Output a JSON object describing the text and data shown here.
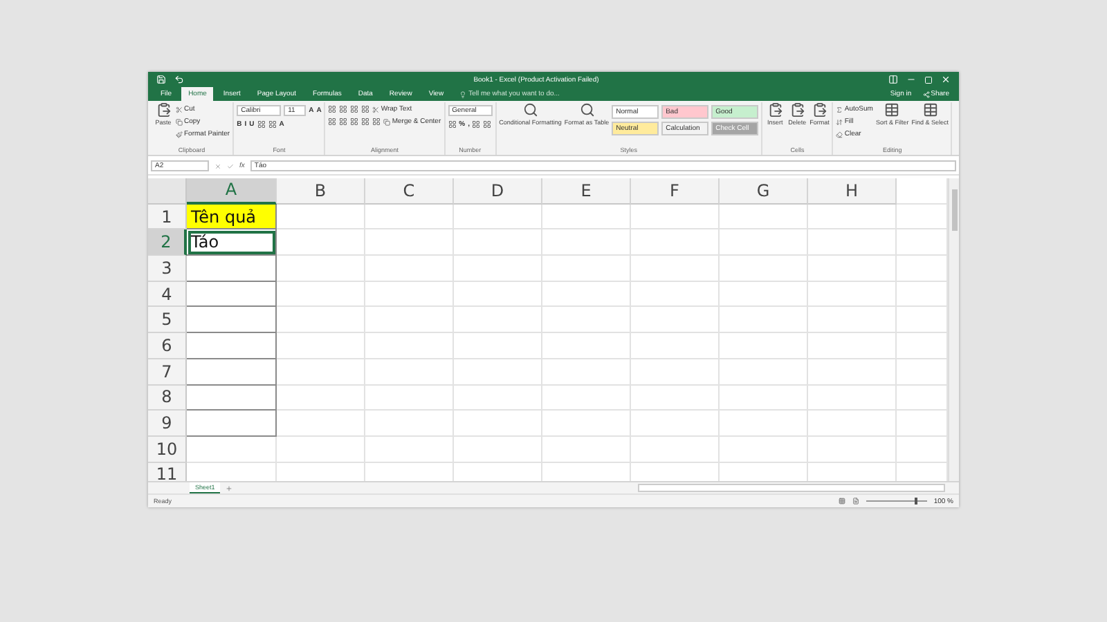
{
  "window": {
    "title": "Book1 - Excel (Product Activation Failed)"
  },
  "ribbon_tabs": [
    {
      "label": "File",
      "selected": false
    },
    {
      "label": "Home",
      "selected": true
    },
    {
      "label": "Insert",
      "selected": false
    },
    {
      "label": "Page Layout",
      "selected": false
    },
    {
      "label": "Formulas",
      "selected": false
    },
    {
      "label": "Data",
      "selected": false
    },
    {
      "label": "Review",
      "selected": false
    },
    {
      "label": "View",
      "selected": false
    }
  ],
  "tell_me": {
    "placeholder": "Tell me what you want to do..."
  },
  "account": {
    "sign_in": "Sign in",
    "share": "Share"
  },
  "ribbon_groups": [
    {
      "label": "Clipboard",
      "blocks": [
        {
          "kind": "large",
          "label": "Paste"
        },
        {
          "kind": "stack",
          "rows": [
            {
              "items": [
                {
                  "kind": "icon-text",
                  "label": "Cut"
                }
              ]
            },
            {
              "items": [
                {
                  "kind": "icon-text",
                  "label": "Copy"
                }
              ]
            },
            {
              "items": [
                {
                  "kind": "icon-text",
                  "label": "Format Painter"
                }
              ]
            }
          ]
        }
      ]
    },
    {
      "label": "Font",
      "blocks": [
        {
          "kind": "stack",
          "rows": [
            {
              "items": [
                {
                  "kind": "field",
                  "value": "Calibri"
                },
                {
                  "kind": "field",
                  "value": "11"
                },
                {
                  "kind": "text",
                  "label": "A"
                },
                {
                  "kind": "text",
                  "label": "A"
                }
              ]
            },
            {
              "items": [
                {
                  "kind": "text",
                  "label": "B"
                },
                {
                  "kind": "text",
                  "label": "I"
                },
                {
                  "kind": "text",
                  "label": "U"
                },
                {
                  "kind": "icon"
                },
                {
                  "kind": "icon"
                },
                {
                  "kind": "text",
                  "label": "A"
                }
              ]
            }
          ]
        }
      ]
    },
    {
      "label": "Alignment",
      "blocks": [
        {
          "kind": "stack",
          "rows": [
            {
              "items": [
                {
                  "kind": "icon"
                },
                {
                  "kind": "icon"
                },
                {
                  "kind": "icon"
                },
                {
                  "kind": "icon"
                },
                {
                  "kind": "icon-text",
                  "label": "Wrap Text"
                }
              ]
            },
            {
              "items": [
                {
                  "kind": "icon"
                },
                {
                  "kind": "icon"
                },
                {
                  "kind": "icon"
                },
                {
                  "kind": "icon"
                },
                {
                  "kind": "icon"
                },
                {
                  "kind": "icon-text",
                  "label": "Merge & Center"
                }
              ]
            }
          ]
        }
      ]
    },
    {
      "label": "Number",
      "blocks": [
        {
          "kind": "stack",
          "rows": [
            {
              "items": [
                {
                  "kind": "field",
                  "value": "General"
                }
              ]
            },
            {
              "items": [
                {
                  "kind": "icon"
                },
                {
                  "kind": "text",
                  "label": "%"
                },
                {
                  "kind": "text",
                  "label": ","
                },
                {
                  "kind": "icon"
                },
                {
                  "kind": "icon"
                }
              ]
            }
          ]
        }
      ]
    },
    {
      "label": "Styles",
      "blocks": [
        {
          "kind": "large",
          "label": "Conditional Formatting"
        },
        {
          "kind": "large",
          "label": "Format as Table"
        },
        {
          "kind": "styles",
          "cells": [
            {
              "label": "Normal",
              "color": "#ffffff"
            },
            {
              "label": "Neutral",
              "color": "#ffeb9c"
            },
            {
              "label": "Bad",
              "color": "#ffc7ce"
            },
            {
              "label": "Calculation",
              "color": "#f2f2f2"
            },
            {
              "label": "Good",
              "color": "#c6efce"
            },
            {
              "label": "Check Cell",
              "color": "#a5a5a5"
            }
          ]
        }
      ]
    },
    {
      "label": "Cells",
      "blocks": [
        {
          "kind": "large",
          "label": "Insert"
        },
        {
          "kind": "large",
          "label": "Delete"
        },
        {
          "kind": "large",
          "label": "Format"
        }
      ]
    },
    {
      "label": "Editing",
      "blocks": [
        {
          "kind": "stack",
          "rows": [
            {
              "items": [
                {
                  "kind": "icon-text",
                  "label": "AutoSum"
                }
              ]
            },
            {
              "items": [
                {
                  "kind": "icon-text",
                  "label": "Fill"
                }
              ]
            },
            {
              "items": [
                {
                  "kind": "icon-text",
                  "label": "Clear"
                }
              ]
            }
          ]
        },
        {
          "kind": "large",
          "label": "Sort & Filter"
        },
        {
          "kind": "large",
          "label": "Find & Select"
        }
      ]
    }
  ],
  "formula_bar": {
    "name_box": "A2",
    "fx": "fx",
    "value": "Táo"
  },
  "columns": [
    {
      "label": "A",
      "selected": true
    },
    {
      "label": "B",
      "selected": false
    },
    {
      "label": "C",
      "selected": false
    },
    {
      "label": "D",
      "selected": false
    },
    {
      "label": "E",
      "selected": false
    },
    {
      "label": "F",
      "selected": false
    },
    {
      "label": "G",
      "selected": false
    },
    {
      "label": "H",
      "selected": false
    }
  ],
  "rows": [
    {
      "label": "1",
      "selected": false,
      "cells": [
        {
          "text": "Tên quả",
          "highlighted": true,
          "bordered": true,
          "selected": false
        }
      ]
    },
    {
      "label": "2",
      "selected": true,
      "cells": [
        {
          "text": "Táo",
          "highlighted": false,
          "bordered": true,
          "selected": true
        }
      ]
    },
    {
      "label": "3",
      "selected": false,
      "cells": [
        {
          "highlighted": false,
          "bordered": true,
          "selected": false
        }
      ]
    },
    {
      "label": "4",
      "selected": false,
      "cells": [
        {
          "highlighted": false,
          "bordered": true,
          "selected": false
        }
      ]
    },
    {
      "label": "5",
      "selected": false,
      "cells": [
        {
          "highlighted": false,
          "bordered": true,
          "selected": false
        }
      ]
    },
    {
      "label": "6",
      "selected": false,
      "cells": [
        {
          "highlighted": false,
          "bordered": true,
          "selected": false
        }
      ]
    },
    {
      "label": "7",
      "selected": false,
      "cells": [
        {
          "highlighted": false,
          "bordered": true,
          "selected": false
        }
      ]
    },
    {
      "label": "8",
      "selected": false,
      "cells": [
        {
          "highlighted": false,
          "bordered": true,
          "selected": false
        }
      ]
    },
    {
      "label": "9",
      "selected": false,
      "cells": [
        {
          "highlighted": false,
          "bordered": true,
          "selected": false
        }
      ]
    },
    {
      "label": "10",
      "selected": false,
      "cells": [
        {
          "highlighted": false,
          "bordered": false,
          "selected": false
        }
      ]
    },
    {
      "label": "11",
      "selected": false,
      "cells": [
        {
          "highlighted": false,
          "bordered": false,
          "selected": false
        }
      ]
    }
  ],
  "sheet_tabs": [
    {
      "label": "Sheet1",
      "selected": true
    }
  ],
  "status_bar": {
    "text": "Ready",
    "zoom": "100 %",
    "zoom_slider": {
      "level": 0.8
    }
  }
}
